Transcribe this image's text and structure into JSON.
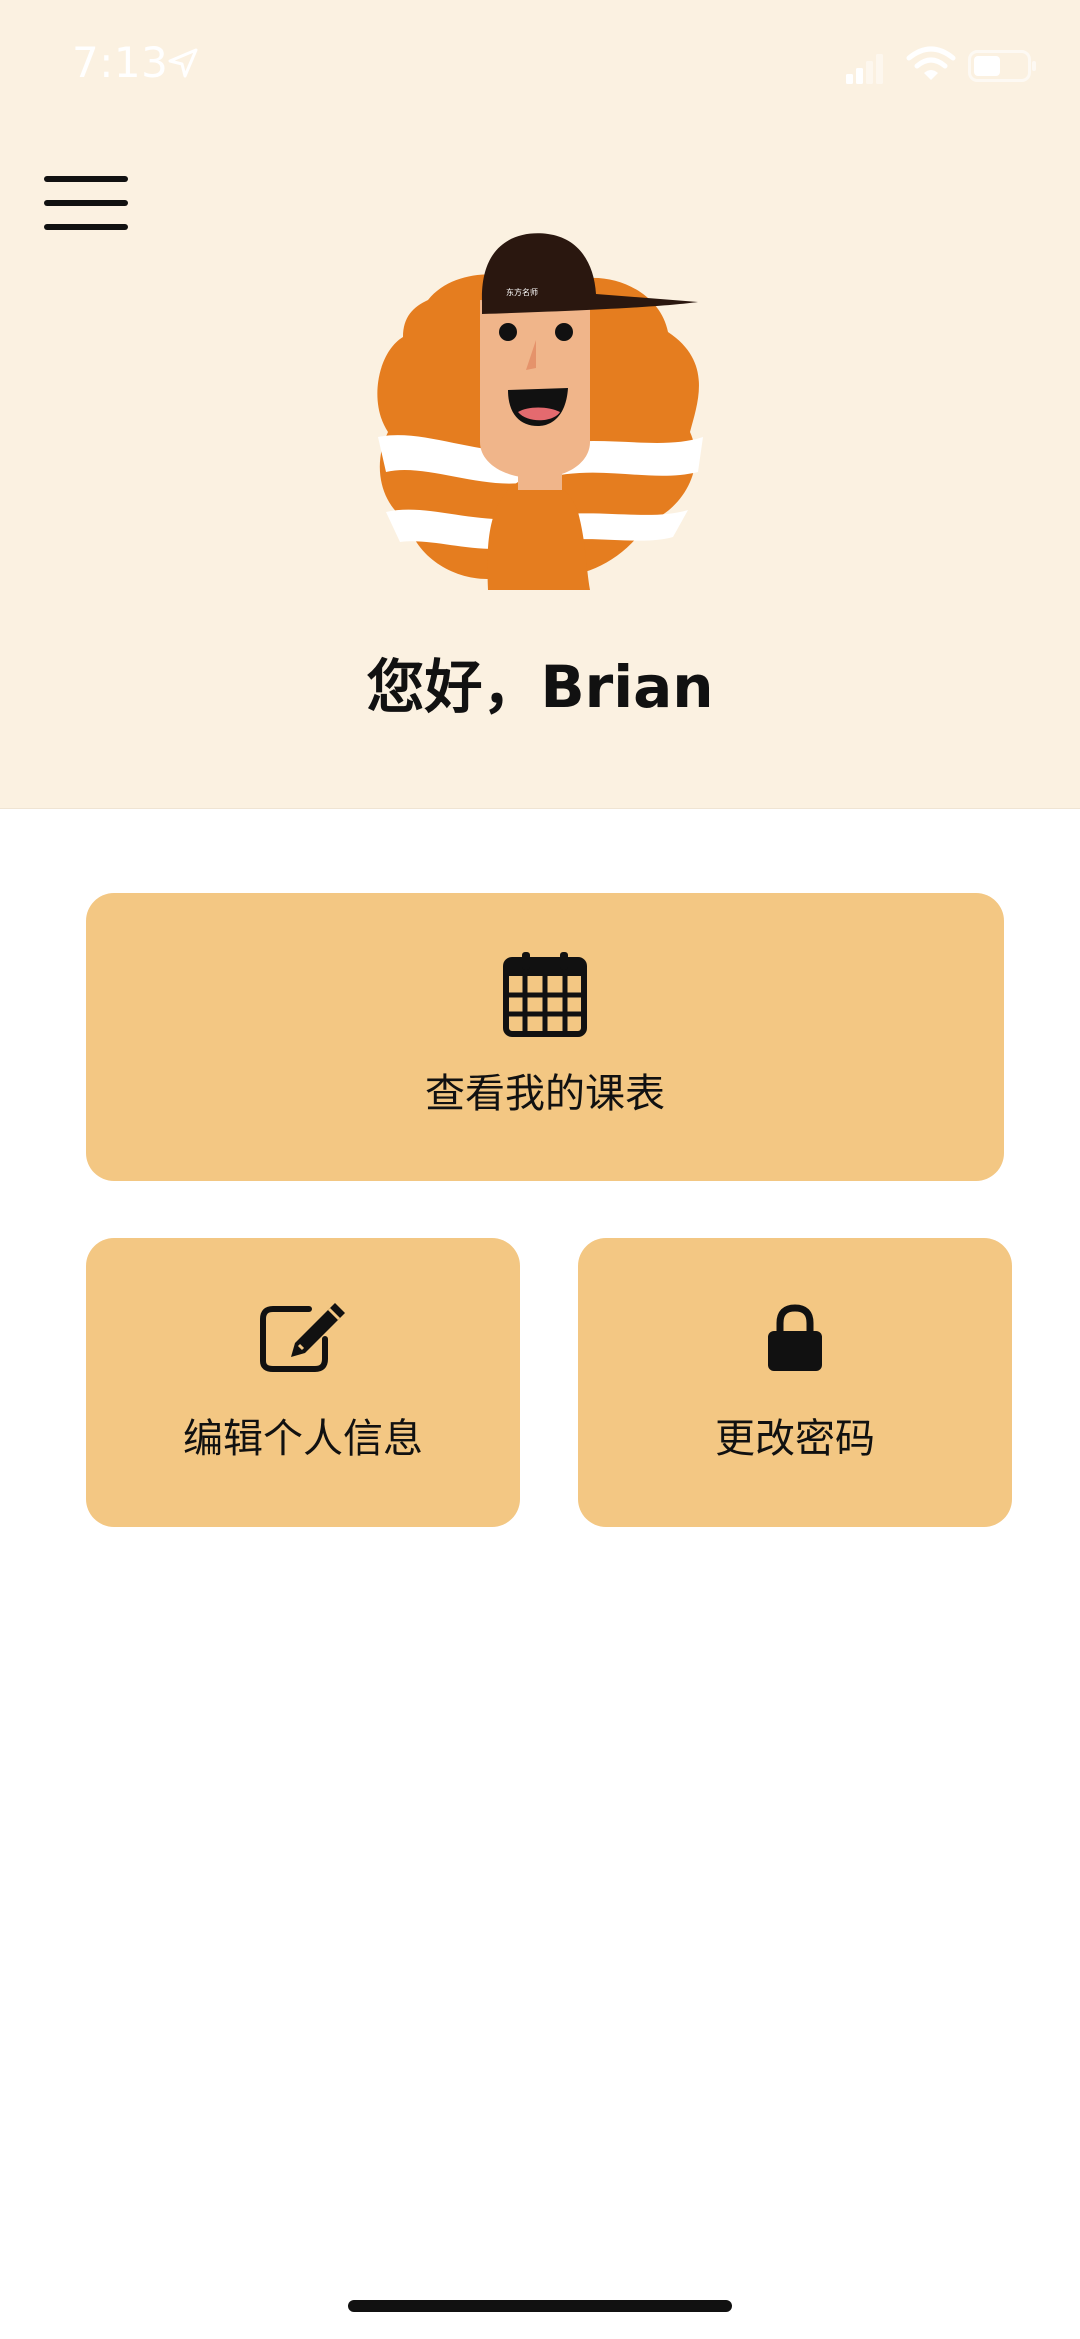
{
  "status_bar": {
    "time": "7:13",
    "icons": [
      "location-arrow-icon",
      "signal-icon",
      "wifi-icon",
      "battery-icon"
    ]
  },
  "header": {
    "menu_icon": "hamburger-menu-icon",
    "avatar": "cartoon-avatar",
    "greeting": "您好，Brian"
  },
  "actions": [
    {
      "label": "查看我的课表",
      "icon": "calendar-icon"
    },
    {
      "label": "编辑个人信息",
      "icon": "edit-icon"
    },
    {
      "label": "更改密码",
      "icon": "lock-icon"
    }
  ],
  "colors": {
    "header_background": "#fbf1e1",
    "tile_background": "#f3c783",
    "avatar_orange": "#e57d1f",
    "avatar_skin": "#f0b58a",
    "avatar_cap": "#2a170f"
  }
}
